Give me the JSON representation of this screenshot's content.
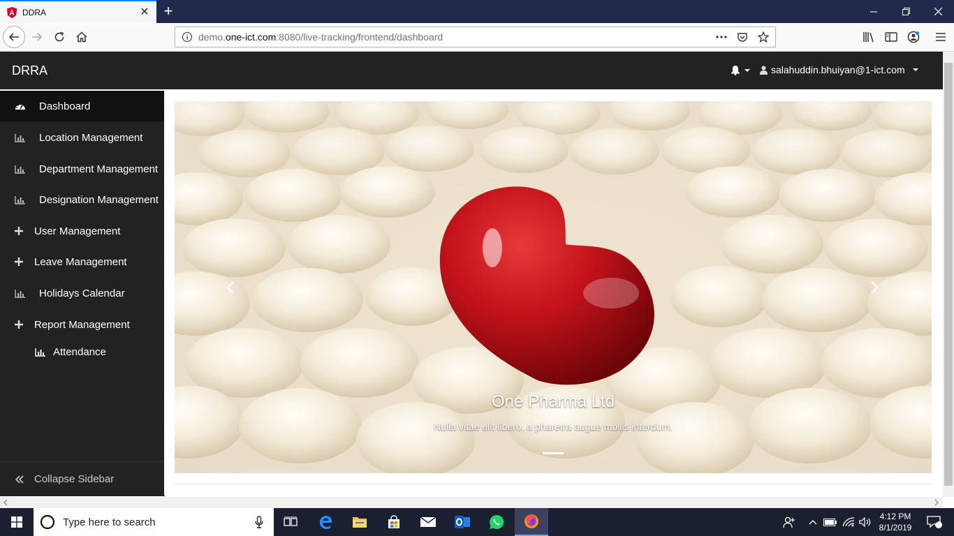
{
  "browser": {
    "tab_title": "DDRA",
    "url_prefix": "demo.",
    "url_domain": "one-ict.com",
    "url_suffix": ":8080/live-tracking/frontend/dashboard",
    "icons": [
      "back-icon",
      "forward-icon",
      "reload-icon",
      "home-icon",
      "info-icon",
      "more-icon",
      "pocket-icon",
      "bookmark-star-icon",
      "library-icon",
      "sidebar-icon",
      "account-icon",
      "menu-icon"
    ]
  },
  "header": {
    "brand": "DRRA",
    "user_email": "salahuddin.bhuiyan@1-ict.com"
  },
  "sidebar": {
    "items": [
      {
        "label": "Dashboard",
        "icon": "dashboard-icon",
        "active": true
      },
      {
        "label": "Location Management",
        "icon": "bar-chart-icon"
      },
      {
        "label": "Department Management",
        "icon": "bar-chart-icon"
      },
      {
        "label": "Designation Management",
        "icon": "bar-chart-icon"
      },
      {
        "label": "User Management",
        "icon": "plus-icon"
      },
      {
        "label": "Leave Management",
        "icon": "plus-icon"
      },
      {
        "label": "Holidays Calendar",
        "icon": "bar-chart-icon"
      },
      {
        "label": "Report Management",
        "icon": "plus-icon"
      }
    ],
    "sub_item": {
      "label": "Attendance",
      "icon": "bar-chart-icon"
    },
    "collapse_label": "Collapse Sidebar"
  },
  "carousel": {
    "caption_title": "One Pharma Ltd",
    "caption_text": "Nulla vitae elit libero, a pharetra augue mollis interdum."
  },
  "taskbar": {
    "search_placeholder": "Type here to search",
    "time": "4:12 PM",
    "date": "8/1/2019",
    "notification_count": "2"
  },
  "colors": {
    "sidebar_bg": "#222222",
    "active_item_bg": "#111111",
    "firefox_tab_accent": "#0a84ff",
    "taskbar_bg": "#1b2030"
  }
}
